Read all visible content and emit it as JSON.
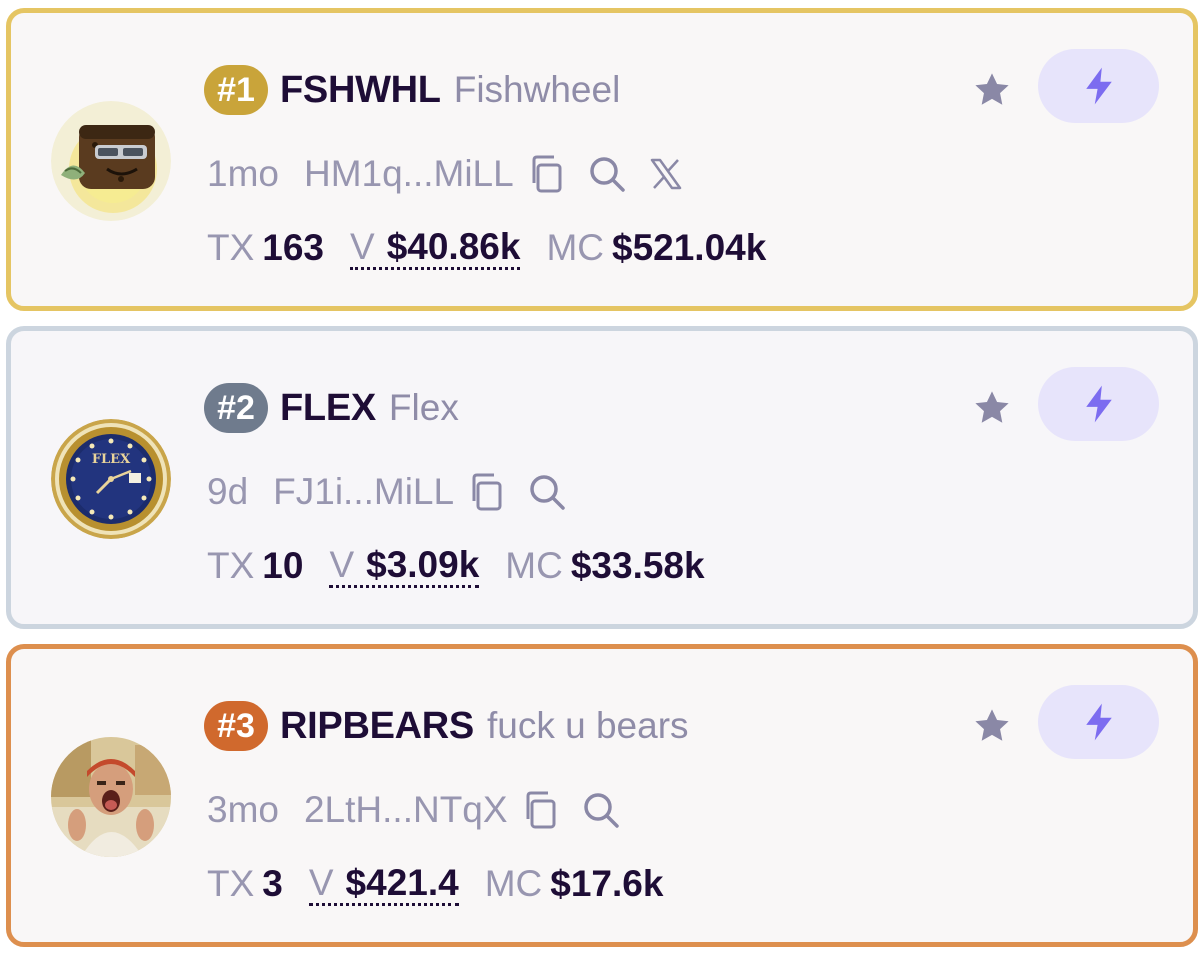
{
  "tokens": [
    {
      "rank": "#1",
      "ticker": "FSHWHL",
      "name": "Fishwheel",
      "age": "1mo",
      "address": "HM1q...MiLL",
      "has_x_link": true,
      "tx_label": "TX",
      "tx": "163",
      "volume_label": "V",
      "volume": "$40.86k",
      "mc_label": "MC",
      "market_cap": "$521.04k",
      "border_color": "#e5c563",
      "rank_color": "#c9a43a",
      "avatar": "fishwheel-avatar"
    },
    {
      "rank": "#2",
      "ticker": "FLEX",
      "name": "Flex",
      "age": "9d",
      "address": "FJ1i...MiLL",
      "has_x_link": false,
      "tx_label": "TX",
      "tx": "10",
      "volume_label": "V",
      "volume": "$3.09k",
      "mc_label": "MC",
      "market_cap": "$33.58k",
      "border_color": "#ccd5df",
      "rank_color": "#6f7b8d",
      "avatar": "flex-watch-avatar",
      "avatar_text": "FLEX"
    },
    {
      "rank": "#3",
      "ticker": "RIPBEARS",
      "name": "fuck u bears",
      "age": "3mo",
      "address": "2LtH...NTqX",
      "has_x_link": false,
      "tx_label": "TX",
      "tx": "3",
      "volume_label": "V",
      "volume": "$421.4",
      "mc_label": "MC",
      "market_cap": "$17.6k",
      "border_color": "#dd8f4e",
      "rank_color": "#d0692d",
      "avatar": "ripbears-avatar"
    }
  ],
  "colors": {
    "text_dark": "#1e0d36",
    "text_muted": "#9896b0",
    "icon_muted": "#8a88a6",
    "quick_buy_bg": "#e7e4fb",
    "quick_buy_icon": "#7c6cf0"
  },
  "icons": {
    "copy": "copy-icon",
    "search": "search-icon",
    "x": "x-logo-icon",
    "favorite": "star-icon",
    "quick_buy": "lightning-bolt-icon"
  }
}
